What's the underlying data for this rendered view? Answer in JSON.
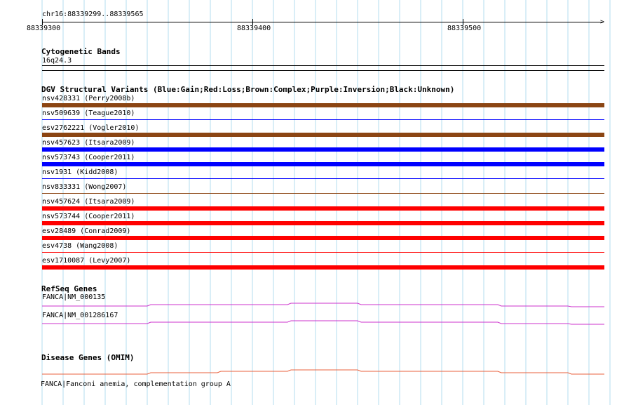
{
  "ruler": {
    "location": "chr16:88339299..88339565",
    "ticks": [
      "88339300",
      "88339400",
      "88339500"
    ]
  },
  "cytobands": {
    "title": "Cytogenetic Bands",
    "band": "16q24.3"
  },
  "dgv": {
    "title": "DGV Structural Variants (Blue:Gain;Red:Loss;Brown:Complex;Purple:Inversion;Black:Unknown)",
    "variants": [
      {
        "label": "nsv428331 (Perry2008b)",
        "color": "#8b4513",
        "type": "Complex",
        "thick": true
      },
      {
        "label": "nsv509639 (Teague2010)",
        "color": "#0000ff",
        "type": "Gain",
        "thick": false
      },
      {
        "label": "esv2762221 (Vogler2010)",
        "color": "#8b4513",
        "type": "Complex",
        "thick": true
      },
      {
        "label": "nsv457623 (Itsara2009)",
        "color": "#0000ff",
        "type": "Gain",
        "thick": true
      },
      {
        "label": "nsv573743 (Cooper2011)",
        "color": "#0000ff",
        "type": "Gain",
        "thick": true
      },
      {
        "label": "nsv1931 (Kidd2008)",
        "color": "#0000ff",
        "type": "Gain",
        "thick": false
      },
      {
        "label": "nsv833331 (Wong2007)",
        "color": "#8b4513",
        "type": "Complex",
        "thick": false
      },
      {
        "label": "nsv457624 (Itsara2009)",
        "color": "#ff0000",
        "type": "Loss",
        "thick": true
      },
      {
        "label": "nsv573744 (Cooper2011)",
        "color": "#ff0000",
        "type": "Loss",
        "thick": true
      },
      {
        "label": "esv28489 (Conrad2009)",
        "color": "#ff0000",
        "type": "Loss",
        "thick": true
      },
      {
        "label": "esv4738 (Wang2008)",
        "color": "#ff0000",
        "type": "Loss",
        "thick": false
      },
      {
        "label": "esv1710087 (Levy2007)",
        "color": "#ff0000",
        "type": "Loss",
        "thick": true
      }
    ]
  },
  "refseq": {
    "title": "RefSeq Genes",
    "genes": [
      {
        "label": "FANCA|NM_000135",
        "color": "#cc33cc"
      },
      {
        "label": "FANCA|NM_001286167",
        "color": "#cc33cc"
      }
    ]
  },
  "disease": {
    "title": "Disease Genes (OMIM)",
    "gene_label": "FANCA|Fanconi anemia, complementation group A",
    "color": "#e8603c"
  },
  "colors": {
    "gridline": "#b3dcef",
    "cytoband_line": "#000000"
  }
}
